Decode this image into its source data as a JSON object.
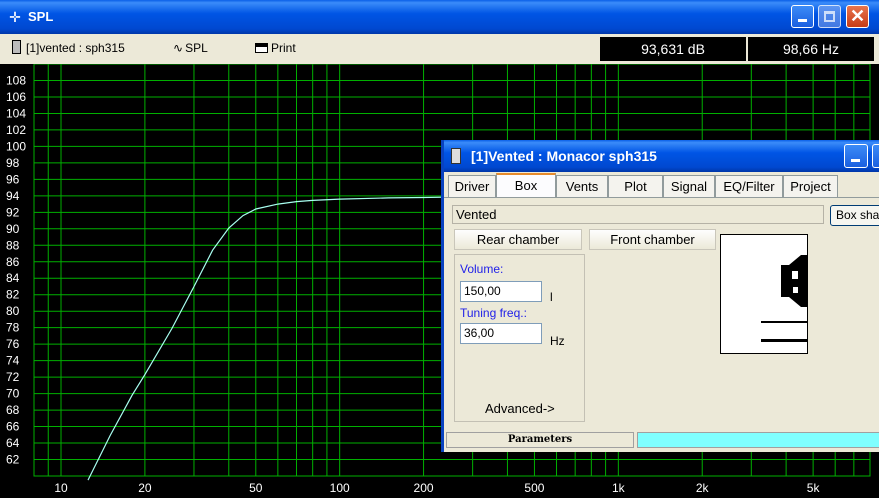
{
  "window": {
    "title": "SPL",
    "icon": "crosshair-icon",
    "controls": [
      "minimize",
      "maximize",
      "close"
    ]
  },
  "toolbar": {
    "project_select": "[1]vented : sph315",
    "view_select": "SPL",
    "print_label": "Print",
    "readout_db": "93,631 dB",
    "readout_hz": "98,66 Hz"
  },
  "chart_data": {
    "type": "line",
    "title": "",
    "xlabel": "",
    "ylabel": "",
    "x_scale": "log",
    "xlim": [
      8,
      8000
    ],
    "ylim": [
      60,
      110
    ],
    "grid": true,
    "background": "#000000",
    "grid_color": "#00b000",
    "line_color": "#a8fff0",
    "x_ticks": [
      "10",
      "20",
      "50",
      "100",
      "200",
      "500",
      "1k",
      "2k",
      "5k"
    ],
    "y_ticks": [
      "62",
      "64",
      "66",
      "68",
      "70",
      "72",
      "74",
      "76",
      "78",
      "80",
      "82",
      "84",
      "86",
      "88",
      "90",
      "92",
      "94",
      "96",
      "98",
      "100",
      "102",
      "104",
      "106",
      "108"
    ],
    "series": [
      {
        "x": [
          12.5,
          15,
          18,
          20,
          25,
          30,
          35,
          40,
          45,
          50,
          60,
          70,
          80,
          100,
          150,
          200,
          300,
          440
        ],
        "y": [
          59.5,
          64.9,
          69.8,
          72.3,
          77.9,
          83.0,
          87.4,
          90.1,
          91.6,
          92.4,
          93.0,
          93.3,
          93.45,
          93.6,
          93.75,
          93.8,
          93.9,
          93.9
        ]
      }
    ]
  },
  "dialog": {
    "title": "[1]Vented : Monacor sph315",
    "tabs": [
      "Driver",
      "Box",
      "Vents",
      "Plot",
      "Signal",
      "EQ/Filter",
      "Project"
    ],
    "active_tab": "Box",
    "box_type": "Vented",
    "box_shape_button": "Box shape",
    "rear_chamber_button": "Rear chamber",
    "front_chamber_button": "Front chamber",
    "volume_label": "Volume:",
    "volume_value": "150,00",
    "volume_unit": "l",
    "tuning_label": "Tuning freq.:",
    "tuning_value": "36,00",
    "tuning_unit": "Hz",
    "advanced_label": "Advanced->",
    "status_left": "Parameters"
  }
}
